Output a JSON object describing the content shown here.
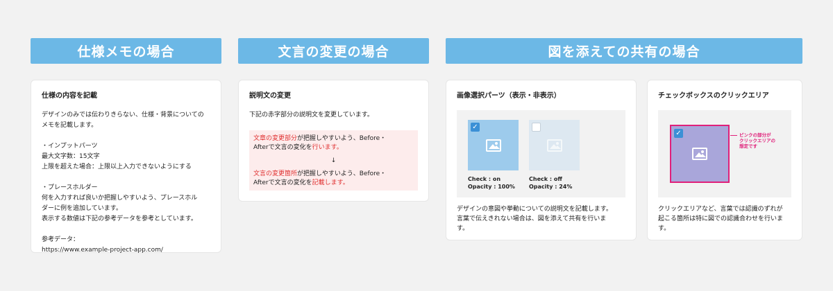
{
  "headers": {
    "spec": "仕様メモの場合",
    "text_change": "文言の変更の場合",
    "figure_share": "図を添えての共有の場合"
  },
  "spec_card": {
    "title": "仕様の内容を記載",
    "intro": "デザインのみでは伝わりきらない、仕様・背景についての\nメモを記載します。",
    "input_parts": "・インプットパーツ\n最大文字数：15文字\n上限を超えた場合：上限以上入力できないようにする",
    "placeholder": "・プレースホルダー\n何を入力すれば良いか把握しやすいよう、プレースホル\nダーに例を追加しています。\n表示する数値は下記の参考データを参考としています。",
    "ref_label": "参考データ：",
    "ref_url": "https://www.example-project-app.com/"
  },
  "text_card": {
    "title": "説明文の変更",
    "lead": "下記の赤字部分の説明文を変更しています。",
    "before_red1": "文章の変更部分",
    "before_mid": "が把握しやすいよう、Before・\nAfterで文言の変化を",
    "before_red2": "行います。",
    "arrow": "↓",
    "after_red1": "文言の変更箇所",
    "after_mid": "が把握しやすいよう、Before・\nAfterで文言の変化を",
    "after_red2": "記載します。"
  },
  "image_card": {
    "title": "画像選択パーツ（表示・非表示）",
    "on_caption": "Check : on\nOpacity : 100%",
    "off_caption": "Check : off\nOpacity : 24%",
    "description": "デザインの意図や挙動についての説明文を記載します。\n言葉で伝えきれない場合は、図を添えて共有を行いま\nす。"
  },
  "checkbox_card": {
    "title": "チェックボックスのクリックエリア",
    "note": "ピンクの部分が\nクリックエリアの\n想定です",
    "description": "クリックエリアなど、言葉では認識のずれが\n起こる箇所は特に図での認識合わせを行いま\nす。"
  },
  "colors": {
    "header": "#6cb8e6",
    "accent_red": "#e03030",
    "pink": "#e0207a",
    "checkbox_blue": "#3b90d6"
  }
}
